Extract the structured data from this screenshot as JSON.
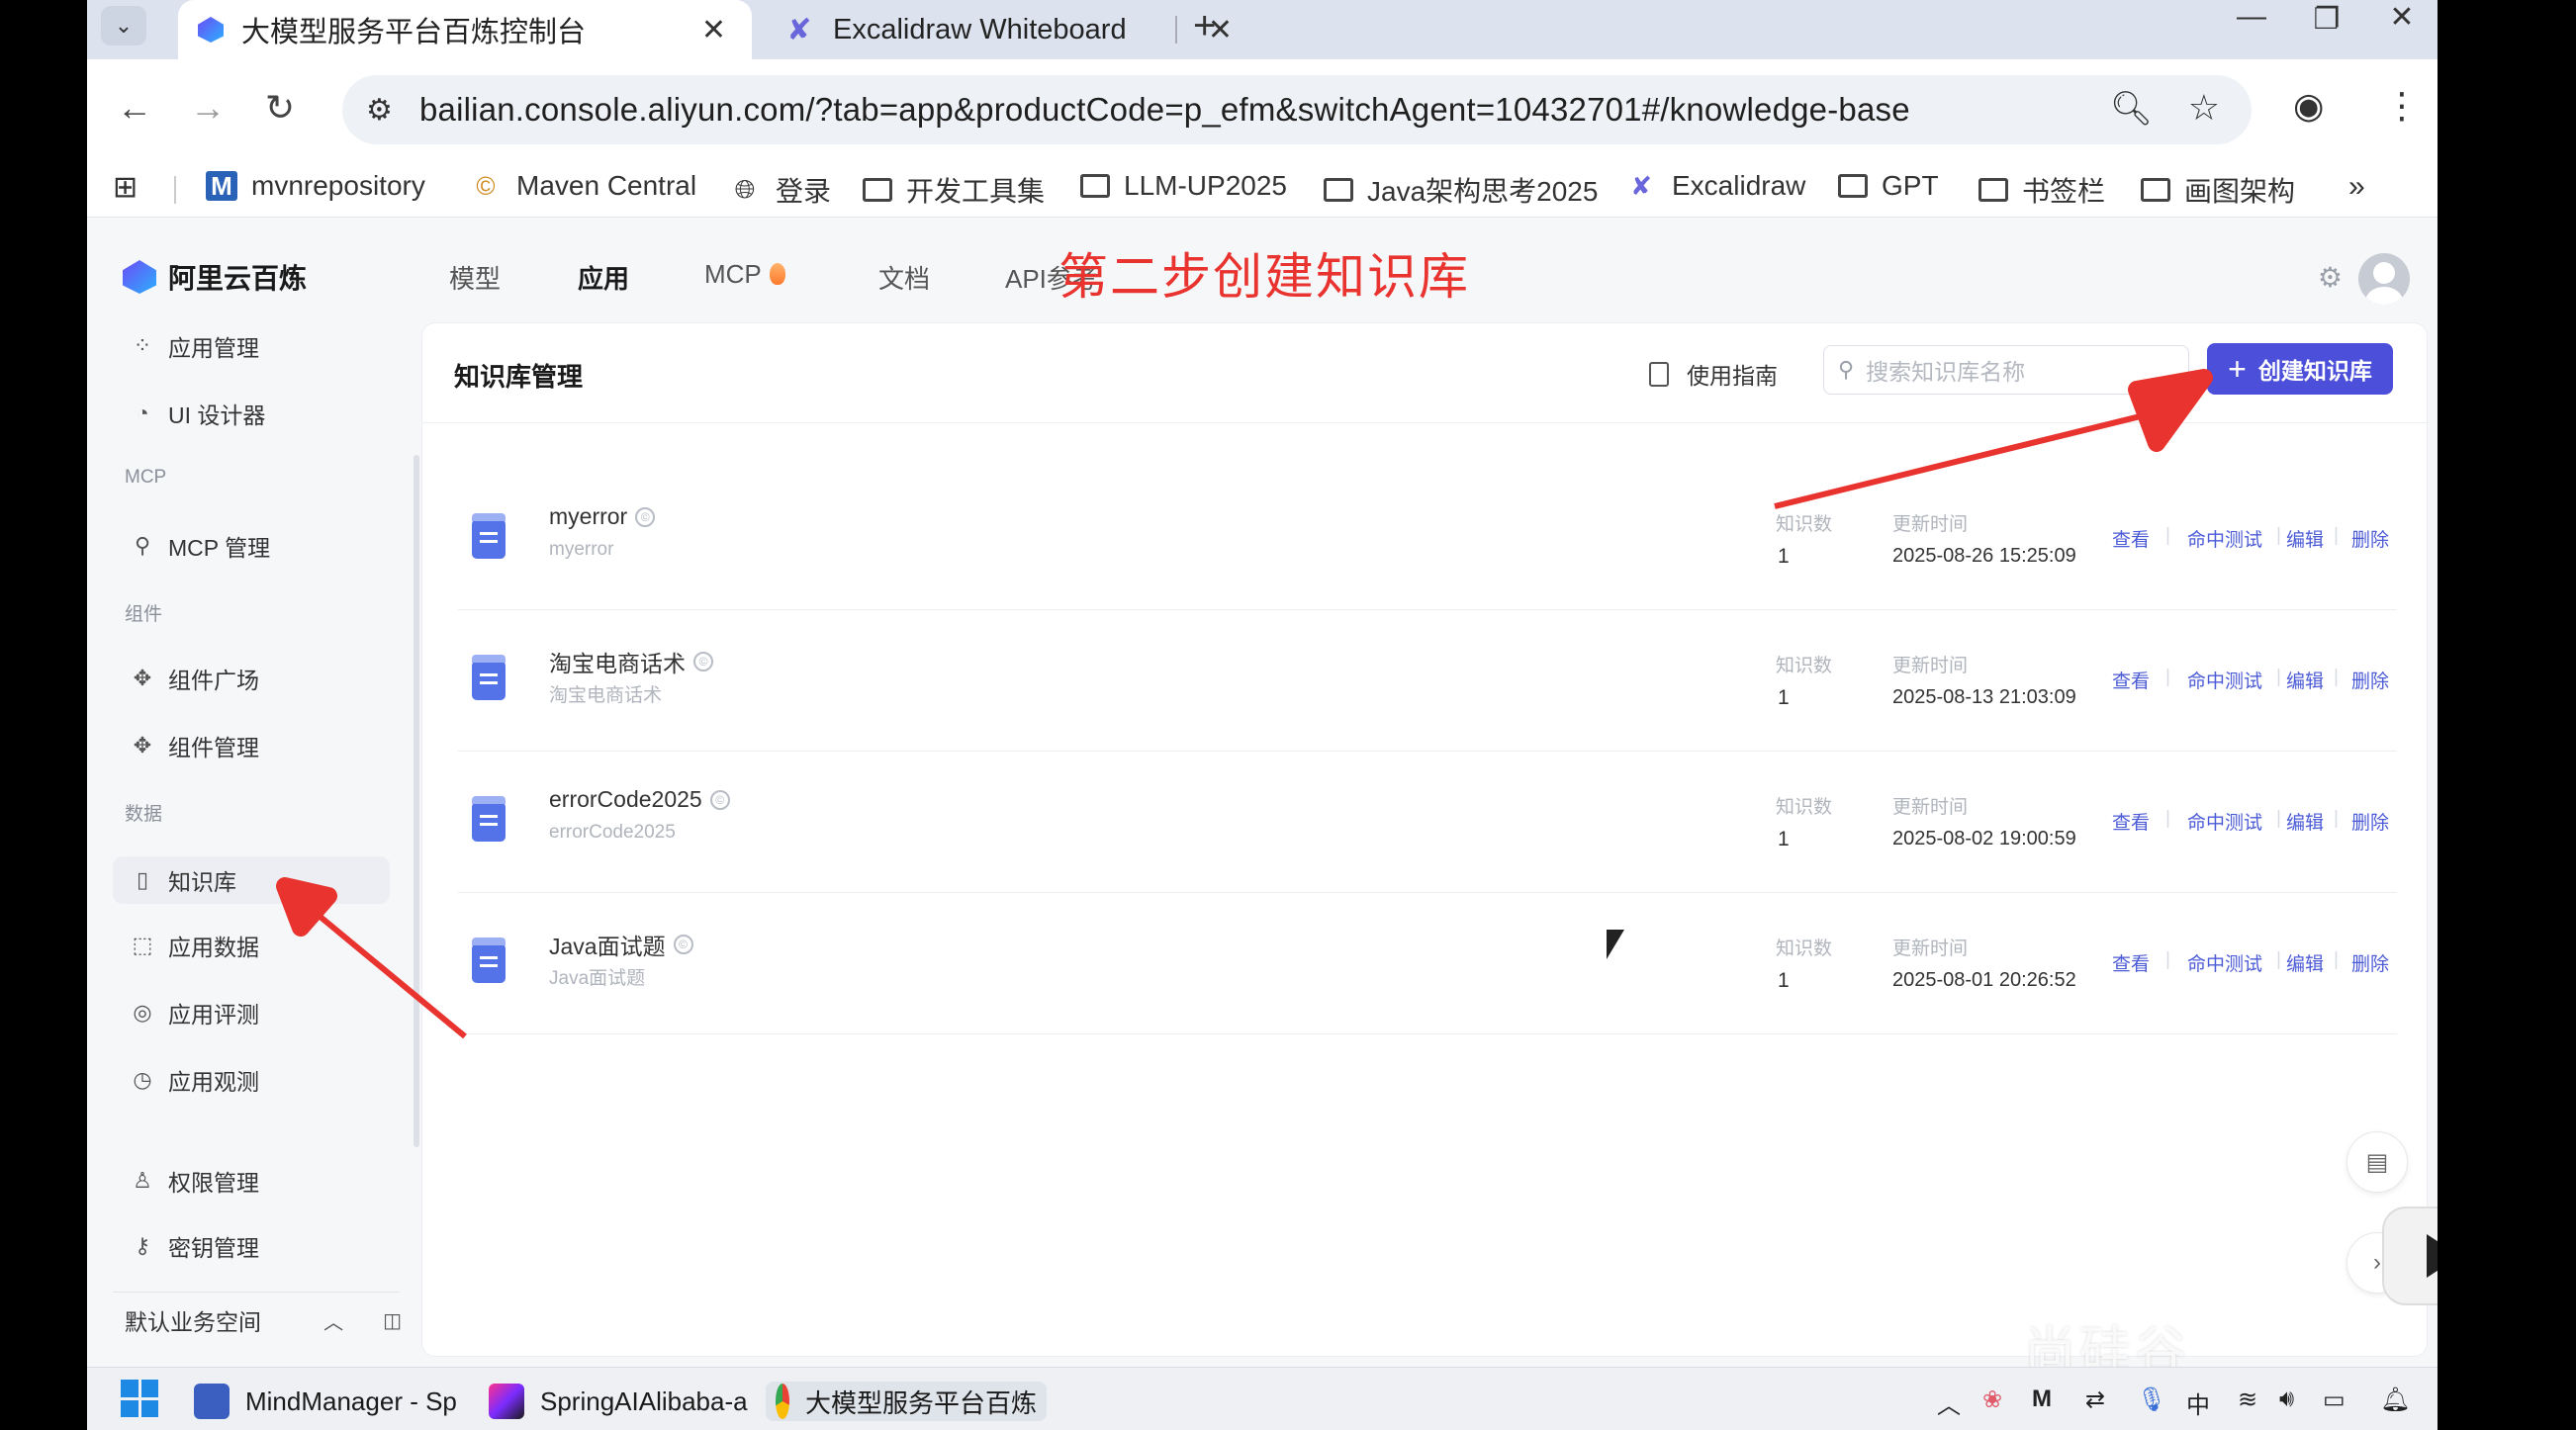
{
  "browser": {
    "tabs": [
      {
        "title": "大模型服务平台百炼控制台",
        "active": true
      },
      {
        "title": "Excalidraw Whiteboard",
        "active": false
      }
    ],
    "url": "bailian.console.aliyun.com/?tab=app&productCode=p_efm&switchAgent=10432701#/knowledge-base",
    "bookmarks": [
      {
        "label": "mvnrepository",
        "icon": "maven-m-icon"
      },
      {
        "label": "Maven Central",
        "icon": "maven-central-icon"
      },
      {
        "label": "登录",
        "icon": "globe-icon"
      },
      {
        "label": "开发工具集",
        "icon": "folder-icon"
      },
      {
        "label": "LLM-UP2025",
        "icon": "folder-icon"
      },
      {
        "label": "Java架构思考2025",
        "icon": "folder-icon"
      },
      {
        "label": "Excalidraw",
        "icon": "excalidraw-icon"
      },
      {
        "label": "GPT",
        "icon": "folder-icon"
      },
      {
        "label": "书签栏",
        "icon": "folder-icon"
      },
      {
        "label": "画图架构",
        "icon": "folder-icon"
      }
    ]
  },
  "app": {
    "logo": "阿里云百炼",
    "topnav": [
      "模型",
      "应用",
      "MCP",
      "文档",
      "API参考"
    ],
    "topnav_active": "应用",
    "sidebar": {
      "items_top": [
        {
          "label": "应用管理",
          "icon": "grid-icon"
        },
        {
          "label": "UI 设计器",
          "icon": "palette-icon"
        }
      ],
      "group_mcp": "MCP",
      "items_mcp": [
        {
          "label": "MCP 管理",
          "icon": "mcp-icon"
        }
      ],
      "group_component": "组件",
      "items_component": [
        {
          "label": "组件广场",
          "icon": "puzzle-icon"
        },
        {
          "label": "组件管理",
          "icon": "puzzle-settings-icon"
        }
      ],
      "group_data": "数据",
      "items_data": [
        {
          "label": "知识库",
          "icon": "book-icon",
          "active": true
        },
        {
          "label": "应用数据",
          "icon": "chart-icon"
        },
        {
          "label": "应用评测",
          "icon": "compass-icon"
        },
        {
          "label": "应用观测",
          "icon": "pie-icon"
        }
      ],
      "items_bottom": [
        {
          "label": "权限管理",
          "icon": "user-icon"
        },
        {
          "label": "密钥管理",
          "icon": "key-icon"
        }
      ],
      "workspace": "默认业务空间"
    },
    "page": {
      "title": "知识库管理",
      "guide": "使用指南",
      "search_placeholder": "搜索知识库名称",
      "create_button": "创建知识库",
      "count_label": "知识数",
      "time_label": "更新时间",
      "actions": [
        "查看",
        "命中测试",
        "编辑",
        "删除"
      ],
      "knowledge_bases": [
        {
          "name": "myerror",
          "desc": "myerror",
          "count": "1",
          "updated": "2025-08-26 15:25:09"
        },
        {
          "name": "淘宝电商话术",
          "desc": "淘宝电商话术",
          "count": "1",
          "updated": "2025-08-13 21:03:09"
        },
        {
          "name": "errorCode2025",
          "desc": "errorCode2025",
          "count": "1",
          "updated": "2025-08-02 19:00:59"
        },
        {
          "name": "Java面试题",
          "desc": "Java面试题",
          "count": "1",
          "updated": "2025-08-01 20:26:52"
        }
      ]
    },
    "annotation": "第二步创建知识库",
    "annotation_color": "#e8332f",
    "accent_color": "#4c4fd9"
  },
  "taskbar": {
    "items": [
      {
        "label": "MindManager - Sp",
        "icon": "mindmanager-icon"
      },
      {
        "label": "SpringAIAlibaba-a",
        "icon": "intellij-icon"
      },
      {
        "label": "大模型服务平台百炼",
        "icon": "chrome-icon",
        "active": true
      }
    ],
    "ime": "中"
  },
  "watermark": "尚硅谷"
}
